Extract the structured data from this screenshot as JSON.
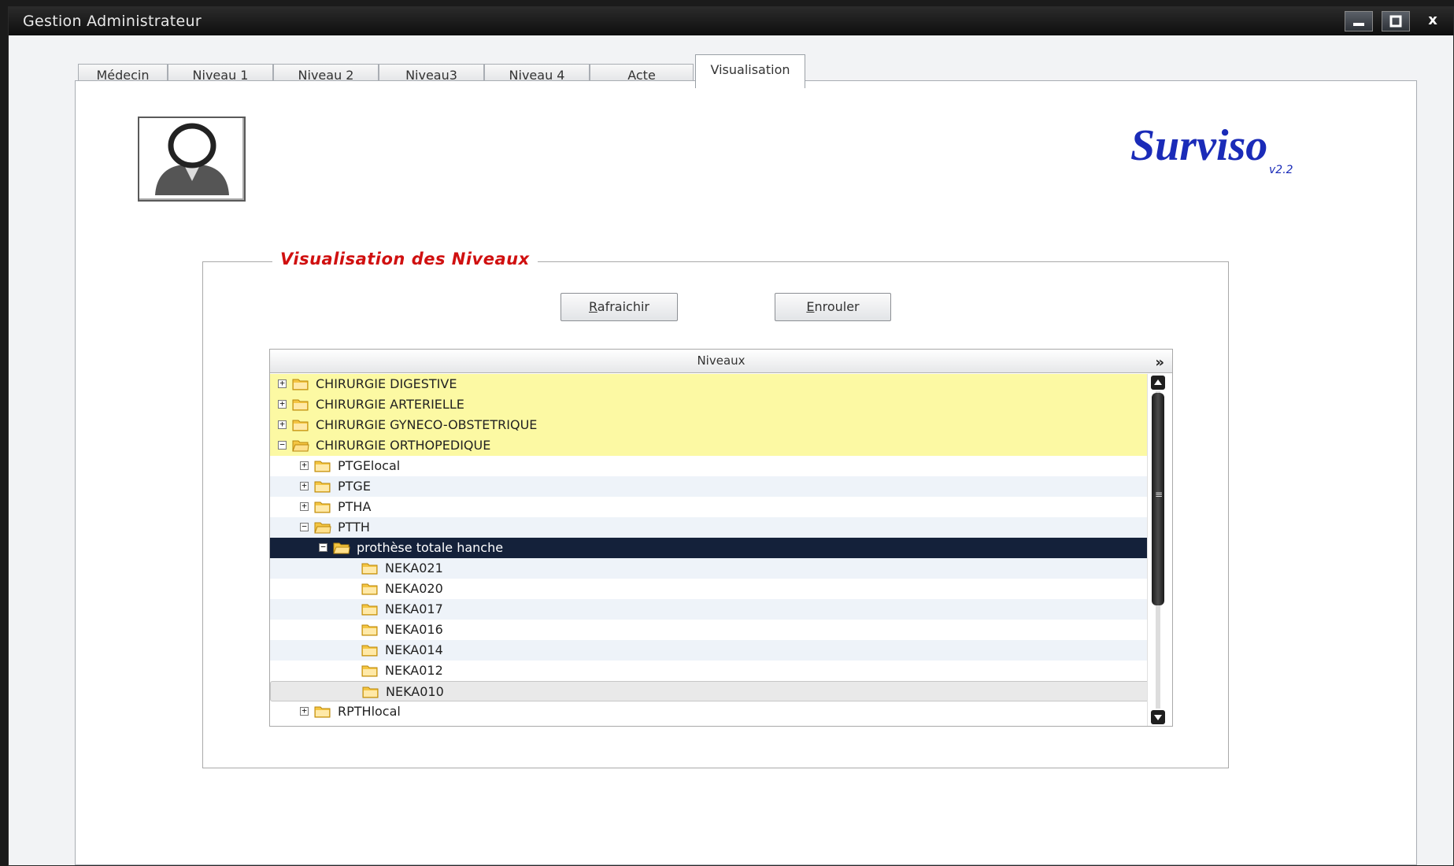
{
  "window": {
    "title": "Gestion Administrateur",
    "min_label": "—",
    "max_label": "□",
    "close_label": "x"
  },
  "tabs": [
    {
      "label": "Médecin"
    },
    {
      "label": "Niveau 1"
    },
    {
      "label": "Niveau 2"
    },
    {
      "label": "Niveau3"
    },
    {
      "label": "Niveau 4"
    },
    {
      "label": "Acte"
    },
    {
      "label": "Visualisation"
    }
  ],
  "active_tab": "Visualisation",
  "logo": {
    "name": "Surviso",
    "version": "v2.2",
    "color": "#1a2bb8"
  },
  "section": {
    "title": "Visualisation des Niveaux",
    "title_color": "#d01010"
  },
  "buttons": {
    "refresh": {
      "mnemonic": "R",
      "rest": "afraichir"
    },
    "enrouler": {
      "mnemonic": "E",
      "rest": "nrouler"
    }
  },
  "tree": {
    "header": "Niveaux",
    "header_icon": "double-chevron-down-icon",
    "rows": [
      {
        "label": "CHIRURGIE DIGESTIVE",
        "level": 0,
        "toggle": "+"
      },
      {
        "label": "CHIRURGIE ARTERIELLE",
        "level": 0,
        "toggle": "+"
      },
      {
        "label": "CHIRURGIE GYNECO-OBSTETRIQUE",
        "level": 0,
        "toggle": "+"
      },
      {
        "label": "CHIRURGIE ORTHOPEDIQUE",
        "level": 0,
        "toggle": "−"
      },
      {
        "label": "PTGElocal",
        "level": 1,
        "toggle": "+"
      },
      {
        "label": "PTGE",
        "level": 1,
        "toggle": "+"
      },
      {
        "label": "PTHA",
        "level": 1,
        "toggle": "+"
      },
      {
        "label": "PTTH",
        "level": 1,
        "toggle": "−"
      },
      {
        "label": "prothèse totale hanche",
        "level": 2,
        "toggle": "−"
      },
      {
        "label": "NEKA021",
        "level": 3,
        "toggle": ""
      },
      {
        "label": "NEKA020",
        "level": 3,
        "toggle": ""
      },
      {
        "label": "NEKA017",
        "level": 3,
        "toggle": ""
      },
      {
        "label": "NEKA016",
        "level": 3,
        "toggle": ""
      },
      {
        "label": "NEKA014",
        "level": 3,
        "toggle": ""
      },
      {
        "label": "NEKA012",
        "level": 3,
        "toggle": ""
      },
      {
        "label": "NEKA010",
        "level": 3,
        "toggle": ""
      },
      {
        "label": "RPTHlocal",
        "level": 1,
        "toggle": "+"
      }
    ],
    "colors": {
      "highlight": "#fcf9a3",
      "selected": "#14213a",
      "folder": "#f4c542"
    }
  }
}
